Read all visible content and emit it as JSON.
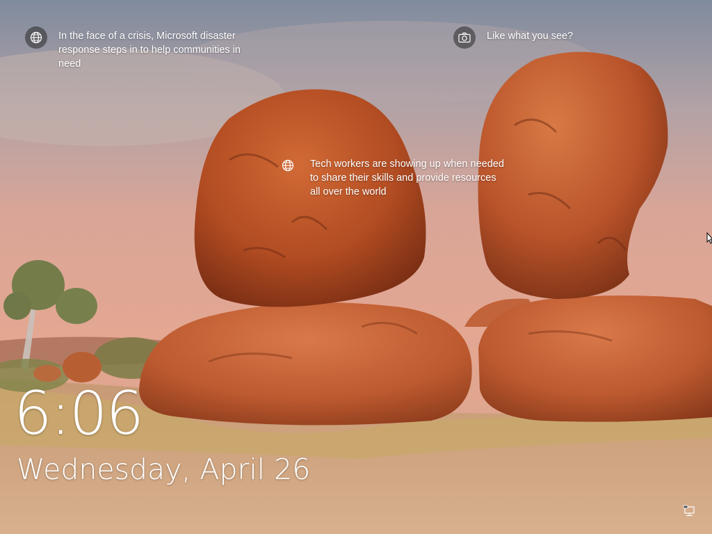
{
  "lock_screen": {
    "spotlight": [
      {
        "icon": "globe-icon",
        "text": "In the face of a crisis, Microsoft disaster response steps in to help communities in need"
      },
      {
        "icon": "camera-icon",
        "text": "Like what you see?"
      },
      {
        "icon": "globe-icon",
        "text": "Tech workers are showing up when needed to share their skills and provide resources all over the world"
      }
    ],
    "time": "6:06",
    "date": "Wednesday, April 26",
    "status_icons": [
      "network-icon"
    ]
  },
  "colors": {
    "text": "#ffffff",
    "rock": "#b94a21",
    "sky": "#d9a395"
  }
}
